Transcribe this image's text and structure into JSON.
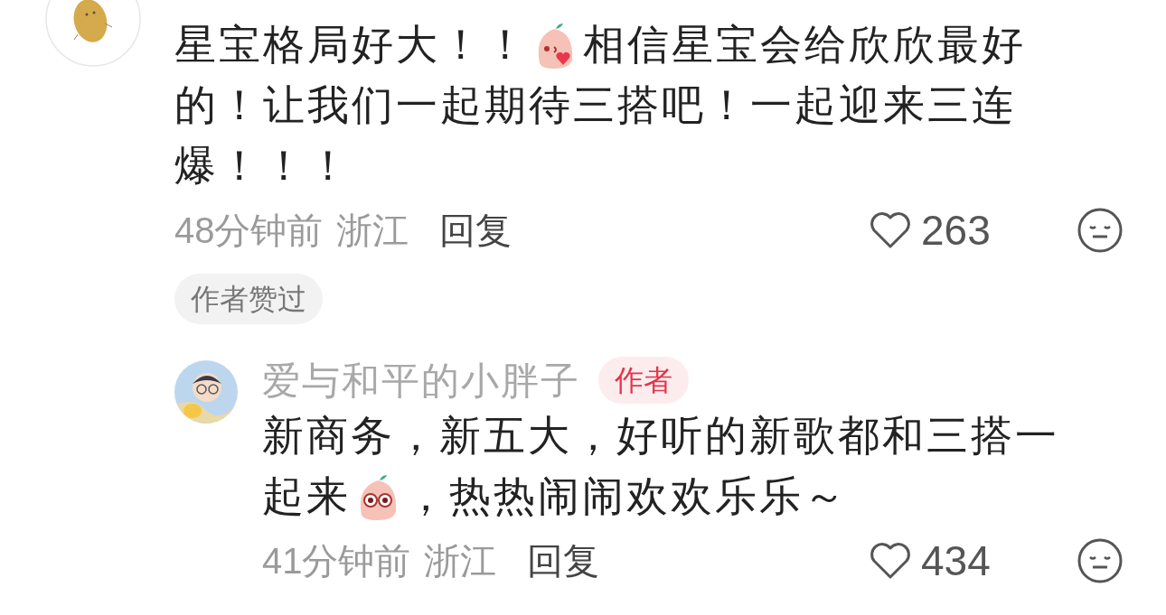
{
  "comments": [
    {
      "lines": [
        [
          {
            "kind": "text",
            "text": "星宝格局好大！！"
          },
          {
            "kind": "emoji"
          },
          {
            "kind": "text",
            "text": "相信星宝会给欣欣最好"
          }
        ],
        [
          {
            "kind": "text",
            "text": "的！让我们一起期待三搭吧！一起迎来三连"
          }
        ],
        [
          {
            "kind": "text",
            "text": "爆！！！"
          }
        ]
      ],
      "time": "48分钟前",
      "location": "浙江",
      "reply": "回复",
      "likes": "263",
      "liked_by_author": "作者赞过"
    },
    {
      "author": "爱与和平的小胖子",
      "author_badge": "作者",
      "lines": [
        [
          {
            "kind": "text",
            "text": "新商务，新五大，好听的新歌都和三搭一"
          }
        ],
        [
          {
            "kind": "text",
            "text": "起来"
          },
          {
            "kind": "emoji"
          },
          {
            "kind": "text",
            "text": "，热热闹闹欢欢乐乐～"
          }
        ]
      ],
      "time": "41分钟前",
      "location": "浙江",
      "reply": "回复",
      "likes": "434"
    }
  ]
}
